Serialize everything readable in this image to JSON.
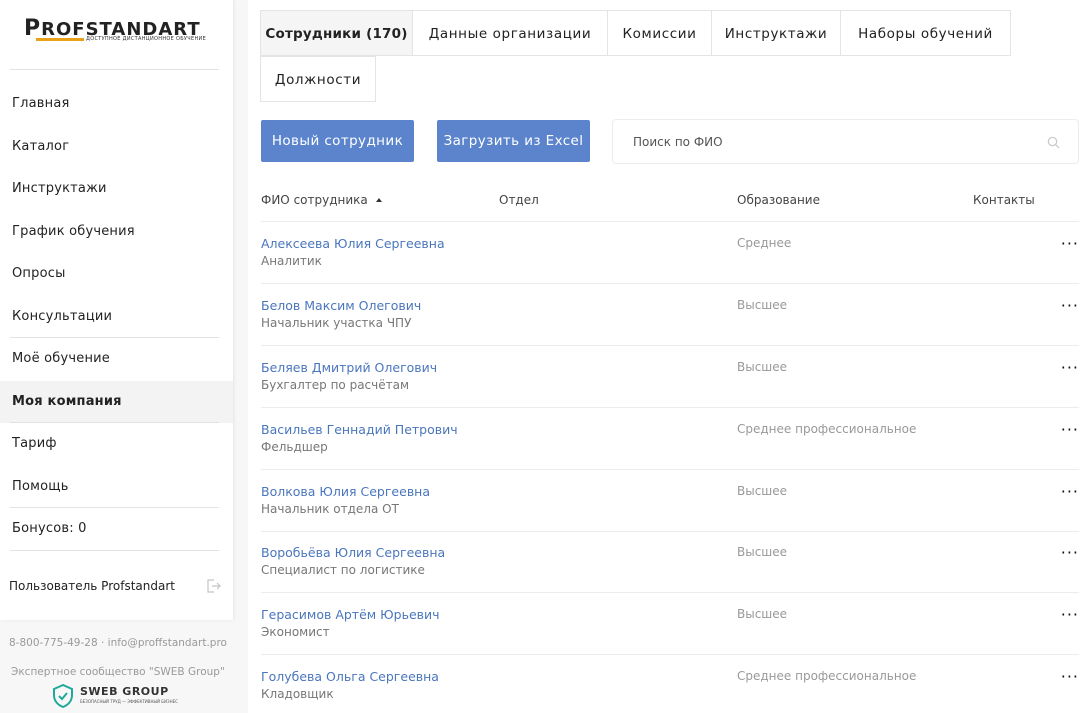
{
  "brand": {
    "name_first": "P",
    "name_rest": "ROFSTANDART",
    "tagline": "ДОСТУПНОЕ ДИСТАНЦИОННОЕ ОБУЧЕНИЕ",
    "accent": "#e8a21a"
  },
  "sidebar": {
    "items": [
      {
        "label": "Главная"
      },
      {
        "label": "Каталог"
      },
      {
        "label": "Инструктажи"
      },
      {
        "label": "График обучения"
      },
      {
        "label": "Опросы"
      },
      {
        "label": "Консультации"
      },
      {
        "label": "Моё обучение"
      },
      {
        "label": "Моя компания",
        "active": true
      },
      {
        "label": "Тариф"
      },
      {
        "label": "Помощь"
      },
      {
        "label": "Бонусов: 0"
      }
    ],
    "user": "Пользователь Profstandart",
    "logout_icon": "logout-icon"
  },
  "footer": {
    "contacts": "8-800-775-49-28 · info@proffstandart.pro",
    "community": "Экспертное сообщество \"SWEB Group\"",
    "partner_logo": "SWEB GROUP",
    "partner_tagline": "БЕЗОПАСНЫЙ ТРУД — ЭФФЕКТИВНЫЙ БИЗНЕС"
  },
  "tabs": [
    {
      "label": "Сотрудники (170)",
      "active": true
    },
    {
      "label": "Данные организации"
    },
    {
      "label": "Комиссии"
    },
    {
      "label": "Инструктажи"
    },
    {
      "label": "Наборы обучений"
    },
    {
      "label": "Должности"
    }
  ],
  "actions": {
    "new_employee": "Новый сотрудник",
    "upload_excel": "Загрузить из Excel",
    "button_color": "#5b84cc"
  },
  "search": {
    "placeholder": "Поиск по ФИО",
    "value": "",
    "icon": "search-icon"
  },
  "table": {
    "columns": [
      "ФИО сотрудника",
      "Отдел",
      "Образование",
      "Контакты"
    ],
    "sort": {
      "column": "ФИО сотрудника",
      "direction": "asc"
    },
    "more_label": "···",
    "rows": [
      {
        "name": "Алексеева Юлия Сергеевна",
        "position": "Аналитик",
        "department": "",
        "education": "Среднее"
      },
      {
        "name": "Белов Максим Олегович",
        "position": "Начальник участка ЧПУ",
        "department": "",
        "education": "Высшее"
      },
      {
        "name": "Беляев Дмитрий Олегович",
        "position": "Бухгалтер по расчётам",
        "department": "",
        "education": "Высшее"
      },
      {
        "name": "Васильев Геннадий Петрович",
        "position": "Фельдшер",
        "department": "",
        "education": "Среднее профессиональное"
      },
      {
        "name": "Волкова Юлия Сергеевна",
        "position": "Начальник отдела ОТ",
        "department": "",
        "education": "Высшее"
      },
      {
        "name": "Воробьёва Юлия Сергеевна",
        "position": "Специалист по логистике",
        "department": "",
        "education": "Высшее"
      },
      {
        "name": "Герасимов Артём Юрьевич",
        "position": "Экономист",
        "department": "",
        "education": "Высшее"
      },
      {
        "name": "Голубева Ольга Сергеевна",
        "position": "Кладовщик",
        "department": "",
        "education": "Среднее профессиональное"
      }
    ]
  }
}
